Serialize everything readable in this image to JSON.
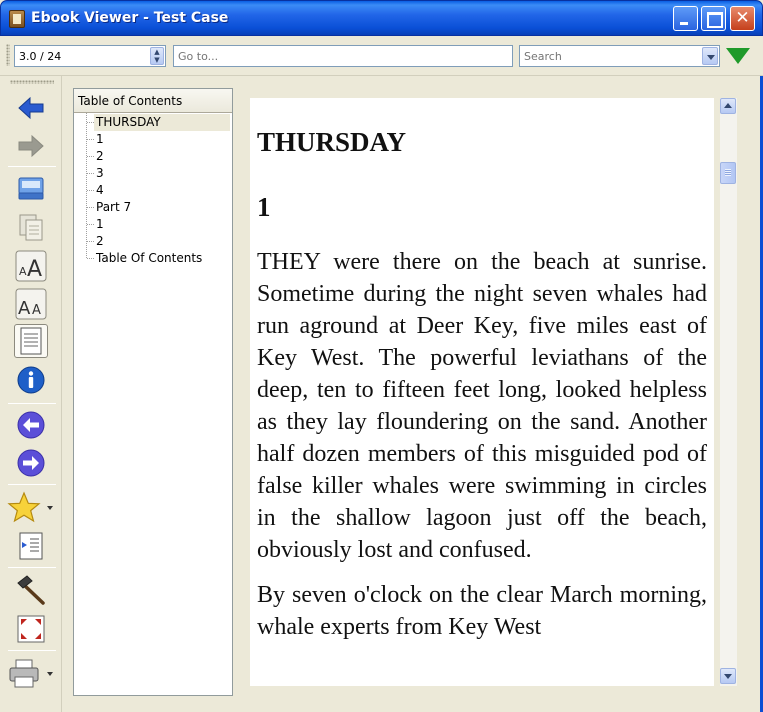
{
  "window": {
    "title": "Ebook Viewer - Test Case"
  },
  "toolbar": {
    "position_value": "3.0 / 24",
    "goto_placeholder": "Go to...",
    "search_placeholder": "Search"
  },
  "toc": {
    "header": "Table of Contents",
    "items": [
      {
        "label": "THURSDAY",
        "selected": true
      },
      {
        "label": "1"
      },
      {
        "label": "2"
      },
      {
        "label": "3"
      },
      {
        "label": "4"
      },
      {
        "label": "Part 7"
      },
      {
        "label": "1"
      },
      {
        "label": "2"
      },
      {
        "label": "Table Of Contents"
      }
    ]
  },
  "book": {
    "chapter_heading": "THURSDAY",
    "section_heading": "1",
    "paragraphs": [
      "THEY were there on the beach at sunrise. Sometime during the night seven whales had run aground at Deer Key, five miles east of Key West. The powerful leviathans of the deep, ten to fifteen feet long, looked helpless as they lay floundering on the sand. Another half dozen members of this misguided pod of false killer whales were swimming in circles in the shallow lagoon just off the beach, obviously lost and confused.",
      "By seven o'clock on the clear March morning, whale experts from Key West"
    ]
  },
  "colors": {
    "titlebar": "#2266e8",
    "accent_green": "#1f9a2a",
    "nav_arrow": "#2a5bd0",
    "nav_circle": "#5b4fd8"
  }
}
